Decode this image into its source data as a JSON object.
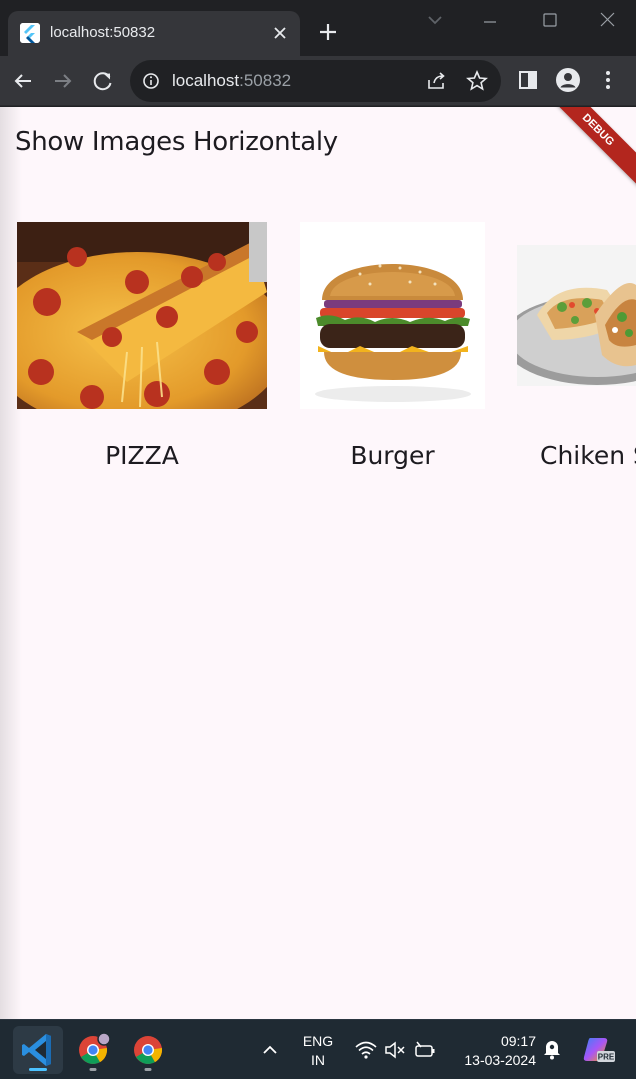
{
  "browser": {
    "tab_title": "localhost:50832",
    "url_host": "localhost",
    "url_port": ":50832"
  },
  "page": {
    "title": "Show Images Horizontaly",
    "debug_banner": "DEBUG",
    "items": [
      {
        "label": "PIZZA"
      },
      {
        "label": "Burger"
      },
      {
        "label": "Chiken S"
      }
    ]
  },
  "taskbar": {
    "lang_line1": "ENG",
    "lang_line2": "IN",
    "time": "09:17",
    "date": "13-03-2024",
    "copilot_badge": "PRE"
  },
  "colors": {
    "page_bg": "#fef7fb",
    "chrome_dark": "#202124",
    "chrome_toolbar": "#35363a",
    "taskbar": "#1f2a33",
    "debug": "#b3261e"
  }
}
